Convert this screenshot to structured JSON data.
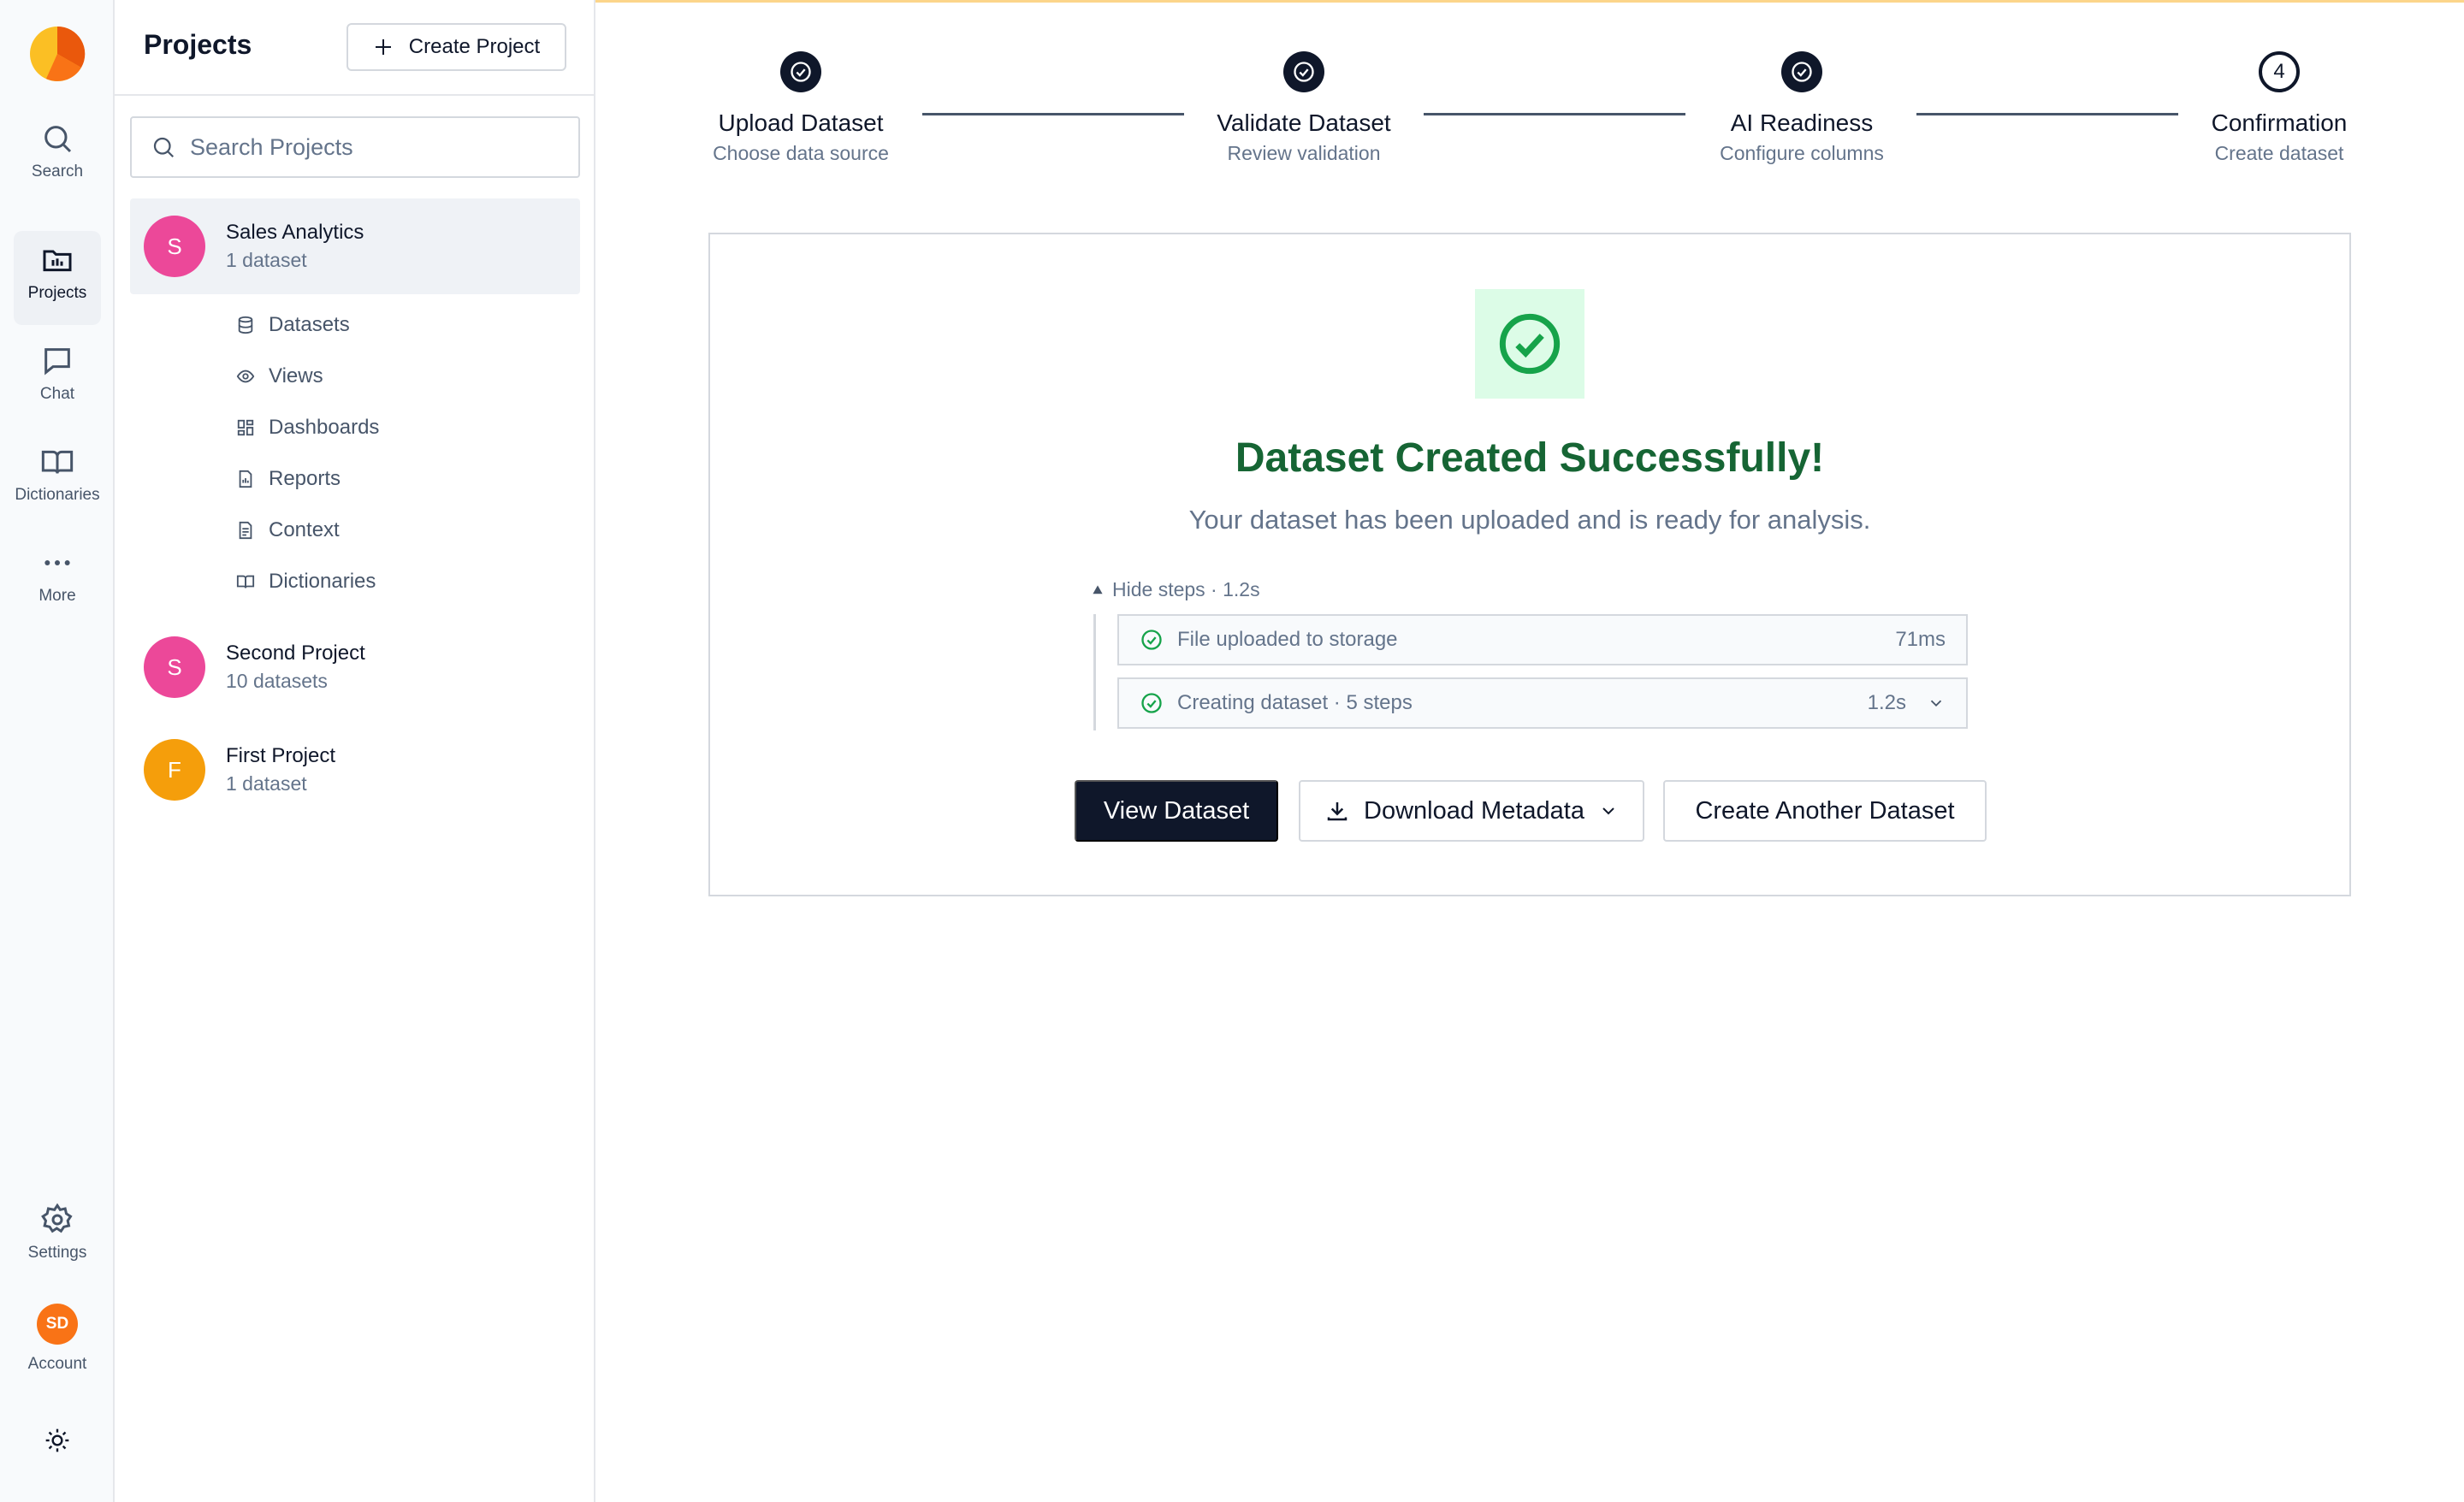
{
  "rail": {
    "items": [
      {
        "label": "Search",
        "icon": "search-icon"
      },
      {
        "label": "Projects",
        "icon": "folder-icon"
      },
      {
        "label": "Chat",
        "icon": "chat-icon"
      },
      {
        "label": "Dictionaries",
        "icon": "book-icon"
      },
      {
        "label": "More",
        "icon": "more-icon"
      }
    ],
    "settings": "Settings",
    "account": "Account",
    "account_initials": "SD"
  },
  "panel": {
    "title": "Projects",
    "create_label": "Create Project",
    "search_placeholder": "Search Projects",
    "projects": [
      {
        "initial": "S",
        "name": "Sales Analytics",
        "count": "1 dataset",
        "color": "#ec4899"
      },
      {
        "initial": "S",
        "name": "Second Project",
        "count": "10 datasets",
        "color": "#ec4899"
      },
      {
        "initial": "F",
        "name": "First Project",
        "count": "1 dataset",
        "color": "#f59e0b"
      }
    ],
    "sub_items": [
      "Datasets",
      "Views",
      "Dashboards",
      "Reports",
      "Context",
      "Dictionaries"
    ]
  },
  "stepper": {
    "steps": [
      {
        "title": "Upload Dataset",
        "sub": "Choose data source",
        "state": "done"
      },
      {
        "title": "Validate Dataset",
        "sub": "Review validation",
        "state": "done"
      },
      {
        "title": "AI Readiness",
        "sub": "Configure columns",
        "state": "done"
      },
      {
        "title": "Confirmation",
        "sub": "Create dataset",
        "state": "current",
        "number": "4"
      }
    ]
  },
  "result": {
    "title": "Dataset Created Successfully!",
    "subtitle": "Your dataset has been uploaded and is ready for analysis.",
    "toggle_label": "Hide steps · 1.2s",
    "rows": [
      {
        "label": "File uploaded to storage",
        "time": "71ms"
      },
      {
        "label": "Creating dataset · 5 steps",
        "time": "1.2s"
      }
    ],
    "buttons": {
      "view": "View Dataset",
      "download": "Download Metadata",
      "create_another": "Create Another Dataset"
    }
  },
  "colors": {
    "accent_dark": "#0f172a",
    "success_green": "#166534",
    "success_bg": "#dcfce7",
    "check_green": "#16a34a"
  }
}
